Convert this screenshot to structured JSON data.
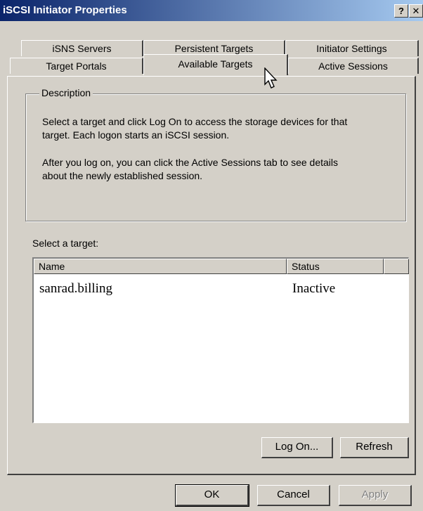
{
  "window": {
    "title": "iSCSI Initiator Properties",
    "help_btn": "?",
    "close_btn": "✕"
  },
  "tabs": {
    "row1": [
      {
        "label": "iSNS Servers"
      },
      {
        "label": "Persistent Targets"
      },
      {
        "label": "Initiator Settings"
      }
    ],
    "row2": [
      {
        "label": "Target Portals"
      },
      {
        "label": "Available Targets",
        "active": true
      },
      {
        "label": "Active Sessions"
      }
    ]
  },
  "description": {
    "legend": "Description",
    "para1_line1": "Select a target and click Log On to access the storage devices for that",
    "para1_line2": "target. Each logon starts an iSCSI session.",
    "para2_line1": "After you log on, you can click the Active Sessions tab to see details",
    "para2_line2": "about the newly established session."
  },
  "target_list": {
    "label": "Select a target:",
    "columns": [
      "Name",
      "Status"
    ],
    "rows": [
      {
        "name": "sanrad.billing",
        "status": "Inactive"
      }
    ]
  },
  "panel_buttons": {
    "logon": "Log On...",
    "refresh": "Refresh"
  },
  "dialog_buttons": {
    "ok": "OK",
    "cancel": "Cancel",
    "apply": "Apply"
  },
  "icons": {
    "cursor": "mouse-pointer-icon"
  }
}
